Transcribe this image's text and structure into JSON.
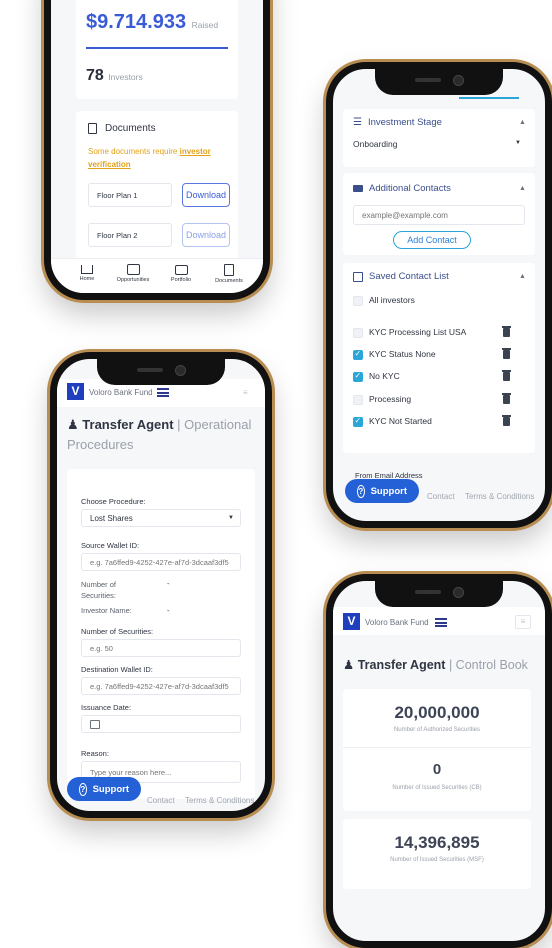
{
  "phone1": {
    "raised_amount": "$9.714.933",
    "raised_label": "Raised",
    "investors_count": "78",
    "investors_label": "Investors",
    "documents_title": "Documents",
    "notice_text": "Some documents require",
    "notice_link": "investor verification",
    "docs": [
      {
        "name": "Floor Plan 1",
        "action": "Download"
      },
      {
        "name": "Floor Plan 2",
        "action": "Download"
      }
    ],
    "nav": [
      "Home",
      "Opportunities",
      "Portfolio",
      "Documents"
    ]
  },
  "phone2": {
    "investment_stage_title": "Investment Stage",
    "investment_stage_value": "Onboarding",
    "additional_contacts_title": "Additional Contacts",
    "email_placeholder": "example@example.com",
    "add_contact": "Add Contact",
    "saved_list_title": "Saved Contact List",
    "lists": [
      {
        "label": "All investors",
        "checked": false
      },
      {
        "label": "KYC Processing List USA",
        "checked": false
      },
      {
        "label": "KYC Status None",
        "checked": true
      },
      {
        "label": "No KYC",
        "checked": true
      },
      {
        "label": "Processing",
        "checked": false
      },
      {
        "label": "KYC Not Started",
        "checked": true
      }
    ],
    "from_email": "From Email Address",
    "support": "Support",
    "footer_contact": "Contact",
    "footer_terms": "Terms & Conditions"
  },
  "phone3": {
    "brand": "Voloro Bank Fund",
    "heading_bold": "Transfer Agent",
    "heading_light": "| Operational Procedures",
    "choose_procedure_label": "Choose Procedure:",
    "procedure_value": "Lost Shares",
    "source_wallet_label": "Source Wallet ID:",
    "source_wallet_placeholder": "e.g. 7a6ffed9-4252-427e-af7d-3dcaaf3df5",
    "num_securities_label_a": "Number of Securities:",
    "num_securities_value_a": "-",
    "investor_name_label": "Investor Name:",
    "investor_name_value": "-",
    "num_securities_label_b": "Number of Securities:",
    "num_securities_placeholder": "e.g. 50",
    "dest_wallet_label": "Destination Wallet ID:",
    "dest_wallet_placeholder": "e.g. 7a6ffed9-4252-427e-af7d-3dcaaf3df5",
    "issuance_date_label": "Issuance Date:",
    "reason_label": "Reason:",
    "reason_placeholder": "Type your reason here...",
    "support": "Support",
    "footer_contact": "Contact",
    "footer_terms": "Terms & Conditions"
  },
  "phone4": {
    "brand": "Voloro Bank Fund",
    "heading_bold": "Transfer Agent",
    "heading_light": "| Control Book",
    "stats": [
      {
        "value": "20,000,000",
        "label": "Number of Authorized Securities"
      },
      {
        "value": "0",
        "label": "Number of Issued Securities (CB)"
      },
      {
        "value": "14,396,895",
        "label": "Number of Issued Securities (MSF)"
      }
    ]
  },
  "colors": {
    "accent": "#3a5bd6",
    "brand": "#1f3fbf",
    "support": "#2561d6",
    "checkbox": "#2ba6d9",
    "warning": "#e2a21b",
    "frame": "#b88d52"
  }
}
